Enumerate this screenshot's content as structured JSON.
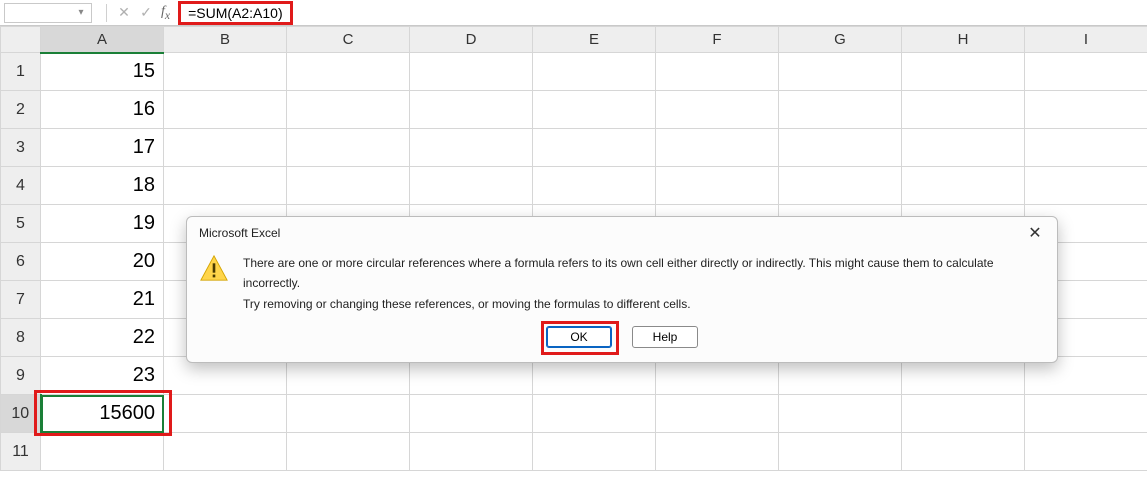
{
  "formula_bar": {
    "name_box_value": "",
    "formula": "=SUM(A2:A10)"
  },
  "columns": [
    "A",
    "B",
    "C",
    "D",
    "E",
    "F",
    "G",
    "H",
    "I"
  ],
  "selected_column": "A",
  "selected_row": 10,
  "active_cell_value": "15600",
  "row_count": 11,
  "data": {
    "1": "15",
    "2": "16",
    "3": "17",
    "4": "18",
    "5": "19",
    "6": "20",
    "7": "21",
    "8": "22",
    "9": "23",
    "10": "15600"
  },
  "dialog": {
    "title": "Microsoft Excel",
    "line1": "There are one or more circular references where a formula refers to its own cell either directly or indirectly. This might cause them to calculate incorrectly.",
    "line2": "Try removing or changing these references, or moving the formulas to different cells.",
    "ok": "OK",
    "help": "Help"
  }
}
